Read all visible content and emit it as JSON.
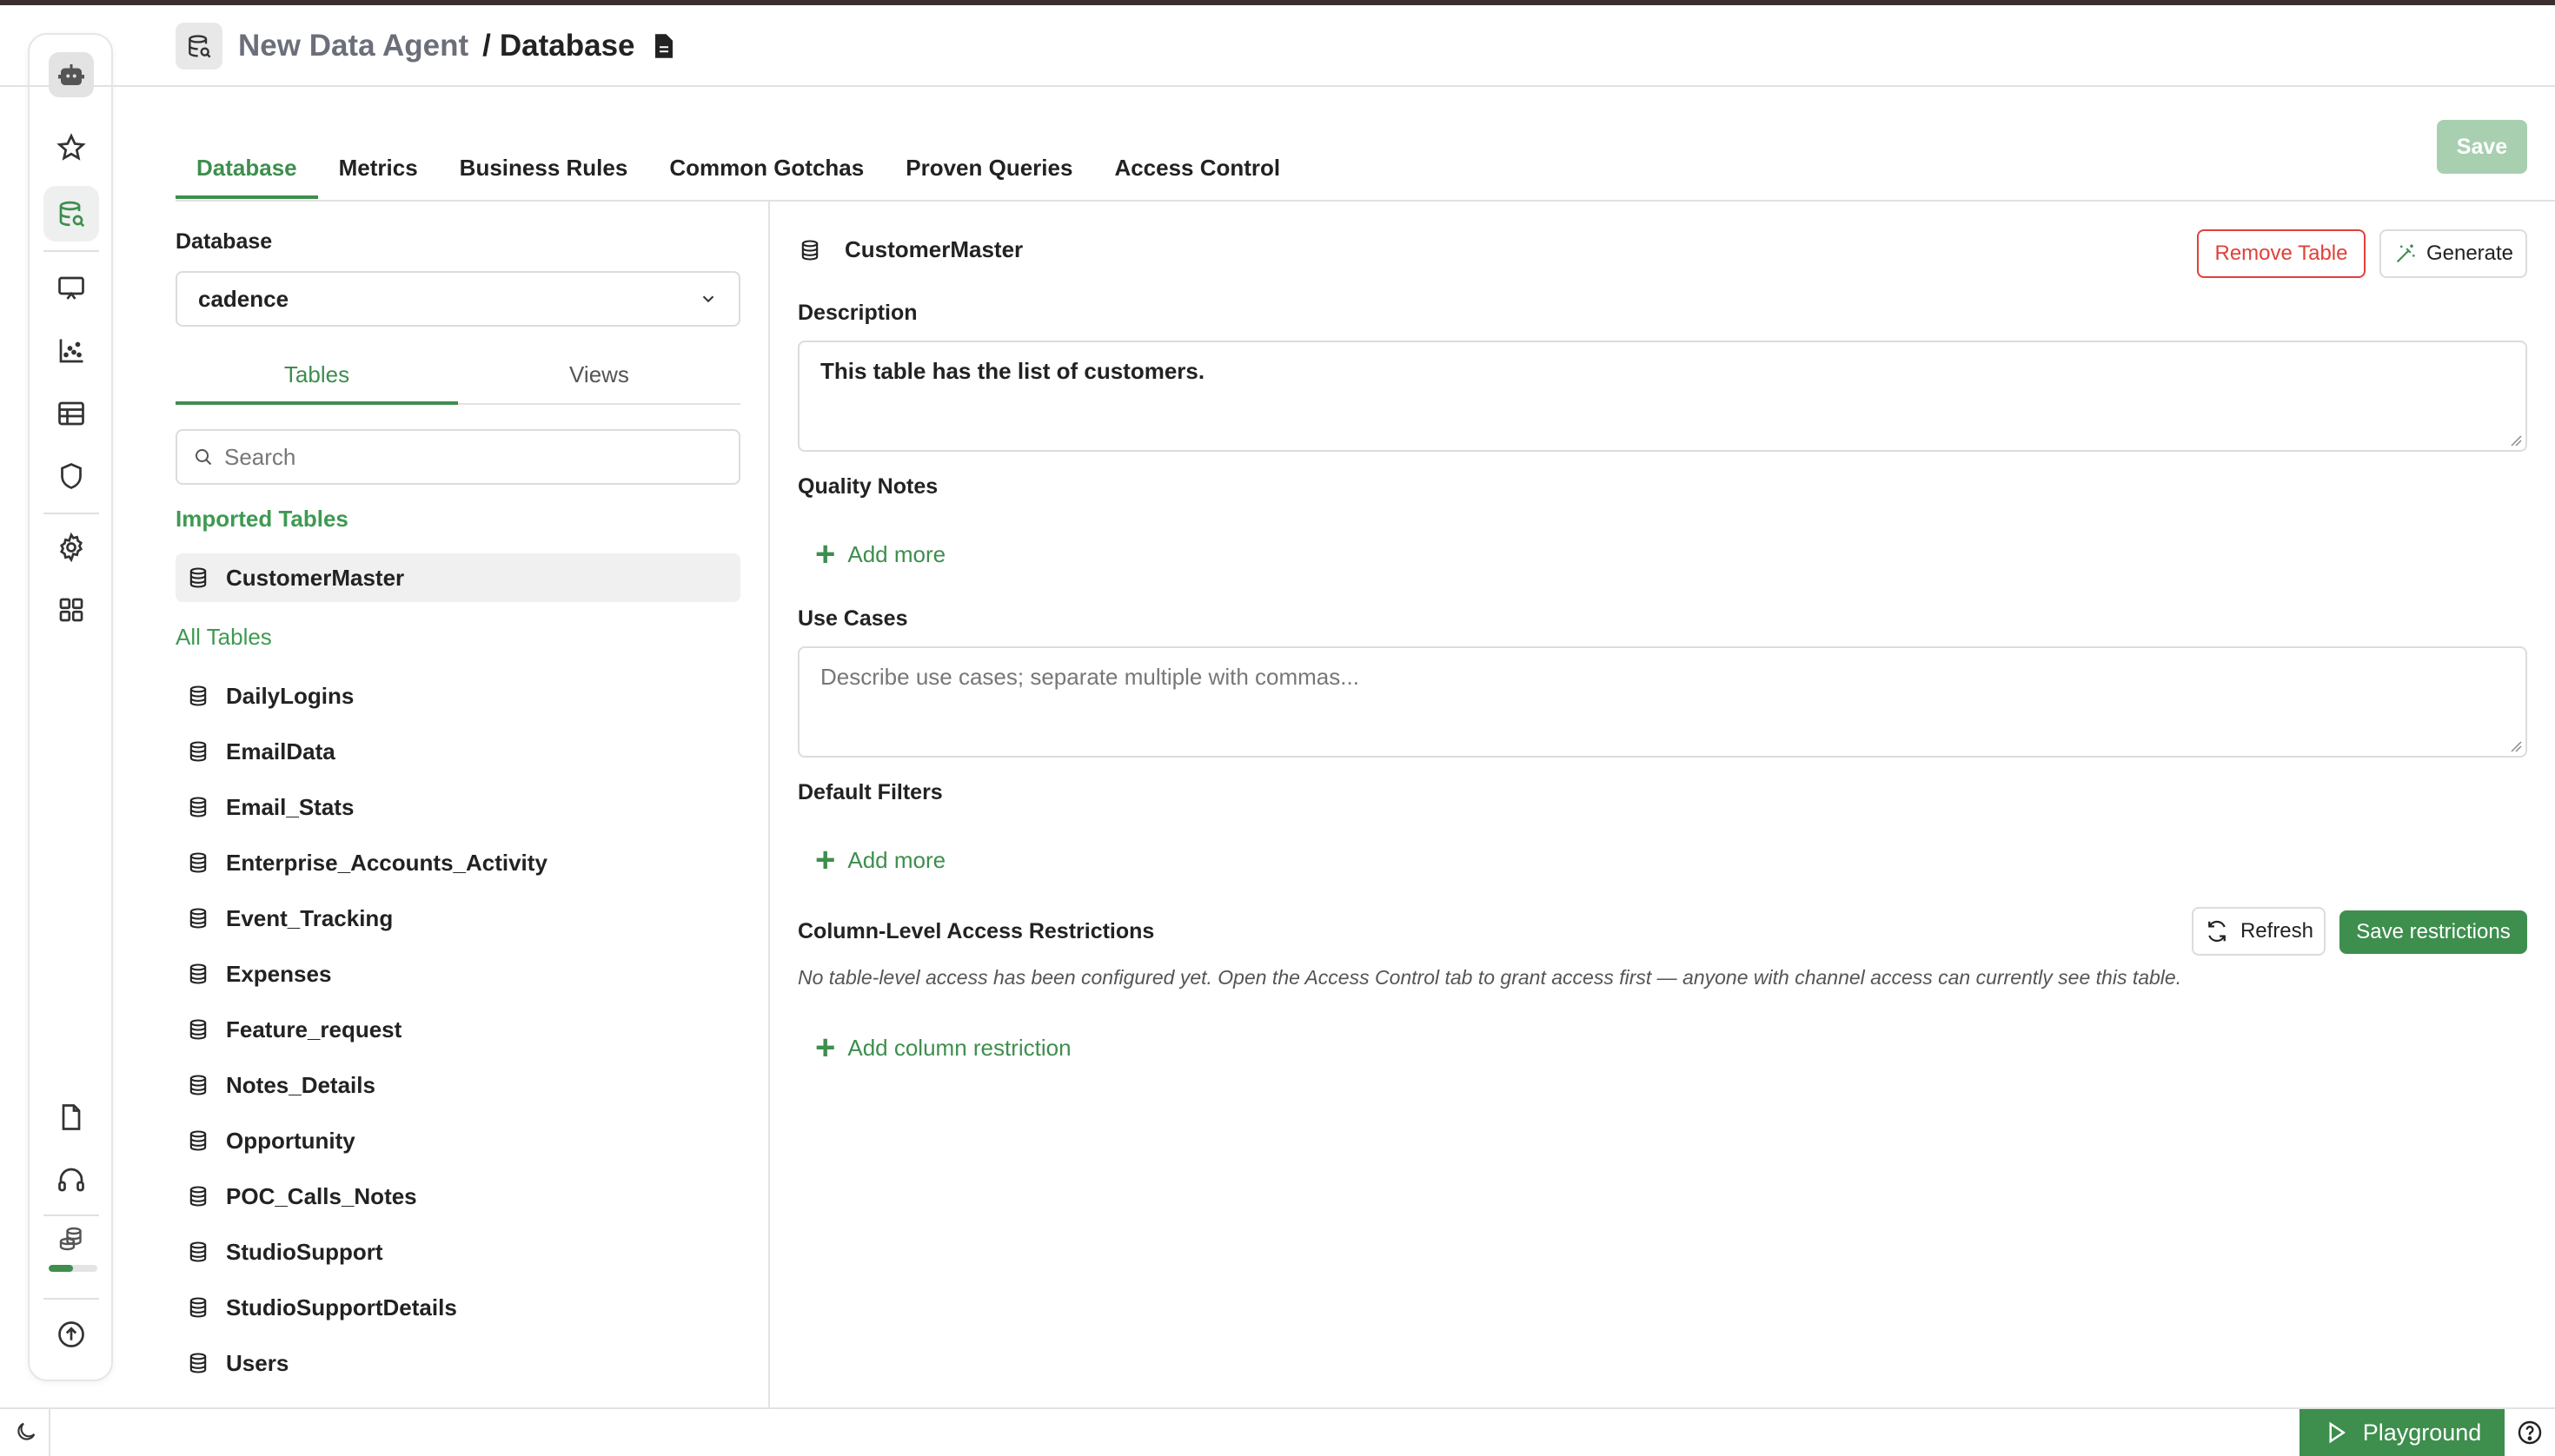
{
  "header": {
    "agent_name": "New Data Agent",
    "separator": "/",
    "page_title": "Database"
  },
  "tabs": [
    {
      "label": "Database",
      "active": true
    },
    {
      "label": "Metrics",
      "active": false
    },
    {
      "label": "Business Rules",
      "active": false
    },
    {
      "label": "Common Gotchas",
      "active": false
    },
    {
      "label": "Proven Queries",
      "active": false
    },
    {
      "label": "Access Control",
      "active": false
    }
  ],
  "toolbar": {
    "save_label": "Save"
  },
  "sidebar": {
    "icons": [
      "robot-icon",
      "star-icon",
      "database-search-icon",
      "presentation-icon",
      "scatter-chart-icon",
      "table-icon",
      "shield-icon",
      "gear-icon",
      "grid-icon",
      "document-icon",
      "headset-icon",
      "coins-icon",
      "upload-icon"
    ],
    "usage_progress": 0.5
  },
  "left_panel": {
    "database_label": "Database",
    "database_value": "cadence",
    "subtabs": [
      "Tables",
      "Views"
    ],
    "active_subtab": "Tables",
    "search_placeholder": "Search",
    "imported_title": "Imported Tables",
    "imported_tables": [
      "CustomerMaster"
    ],
    "all_title": "All Tables",
    "all_tables": [
      "DailyLogins",
      "EmailData",
      "Email_Stats",
      "Enterprise_Accounts_Activity",
      "Event_Tracking",
      "Expenses",
      "Feature_request",
      "Notes_Details",
      "Opportunity",
      "POC_Calls_Notes",
      "StudioSupport",
      "StudioSupportDetails",
      "Users"
    ]
  },
  "detail": {
    "table_name": "CustomerMaster",
    "remove_label": "Remove Table",
    "generate_label": "Generate",
    "description_label": "Description",
    "description_value": "This table has the list of customers.",
    "quality_label": "Quality Notes",
    "add_more_label": "Add more",
    "use_cases_label": "Use Cases",
    "use_cases_placeholder": "Describe use cases; separate multiple with commas...",
    "filters_label": "Default Filters",
    "restrictions_label": "Column-Level Access Restrictions",
    "refresh_label": "Refresh",
    "save_restrictions_label": "Save restrictions",
    "restrictions_note": "No table-level access has been configured yet. Open the Access Control tab to grant access first — anyone with channel access can currently see this table.",
    "add_column_restriction_label": "Add column restriction"
  },
  "footer": {
    "playground_label": "Playground"
  },
  "colors": {
    "accent": "#3e8e4e",
    "danger": "#e0403a",
    "muted_save": "#a8cfb0"
  }
}
